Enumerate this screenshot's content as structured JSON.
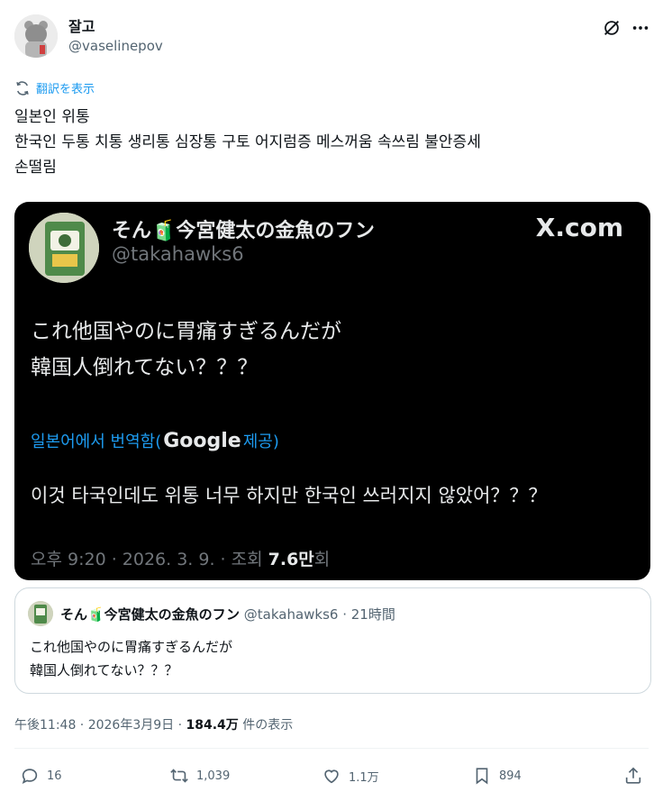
{
  "author": {
    "name": "잘고",
    "handle": "@vaselinepov"
  },
  "header_icons": [
    "grok-icon",
    "more-icon"
  ],
  "translate_label": "翻訳を表示",
  "body_lines": [
    "일본인 위통",
    "한국인 두통 치통 생리통 심장통 구토 어지럼증 메스꺼움 속쓰림 불안증세",
    "손떨림"
  ],
  "screenshot": {
    "name": "そん🧃今宮健太の金魚のフン",
    "handle": "@takahawks6",
    "brand": "X.com",
    "text_lines": [
      "これ他国やのに胃痛すぎるんだが",
      "韓国人倒れてない？？？"
    ],
    "translated_prefix": "일본어에서 번역함(",
    "translated_google": "Google",
    "translated_suffix": " 제공)",
    "translation": "이것 타국인데도 위통 너무 하지만 한국인 쓰러지지 않았어？？？",
    "meta_prefix": "오후 9:20 · 2026. 3. 9. · 조회 ",
    "meta_views": "7.6만",
    "meta_suffix": "회"
  },
  "quote": {
    "name": "そん🧃今宮健太の金魚のフン",
    "handle_time": " @takahawks6 · 21時間",
    "text_lines": [
      "これ他国やのに胃痛すぎるんだが",
      "韓国人倒れてない？？？"
    ]
  },
  "meta": {
    "time_date": "午後11:48 · 2026年3月9日 · ",
    "views": "184.4万",
    "views_suffix": " 件の表示"
  },
  "actions": {
    "replies": "16",
    "reposts": "1,039",
    "likes": "1.1万",
    "bookmarks": "894"
  },
  "colors": {
    "accent": "#1d9bf0",
    "text": "#0f1419",
    "muted": "#536471"
  }
}
